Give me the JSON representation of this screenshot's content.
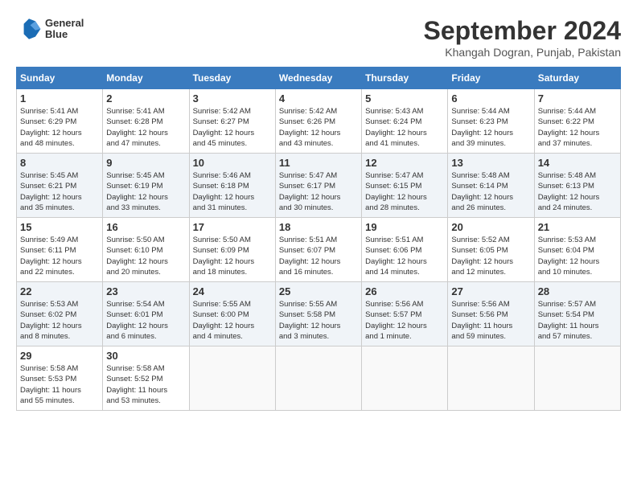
{
  "header": {
    "logo_line1": "General",
    "logo_line2": "Blue",
    "title": "September 2024",
    "subtitle": "Khangah Dogran, Punjab, Pakistan"
  },
  "calendar": {
    "days_of_week": [
      "Sunday",
      "Monday",
      "Tuesday",
      "Wednesday",
      "Thursday",
      "Friday",
      "Saturday"
    ],
    "weeks": [
      [
        {
          "day": "",
          "detail": ""
        },
        {
          "day": "2",
          "detail": "Sunrise: 5:41 AM\nSunset: 6:28 PM\nDaylight: 12 hours\nand 47 minutes."
        },
        {
          "day": "3",
          "detail": "Sunrise: 5:42 AM\nSunset: 6:27 PM\nDaylight: 12 hours\nand 45 minutes."
        },
        {
          "day": "4",
          "detail": "Sunrise: 5:42 AM\nSunset: 6:26 PM\nDaylight: 12 hours\nand 43 minutes."
        },
        {
          "day": "5",
          "detail": "Sunrise: 5:43 AM\nSunset: 6:24 PM\nDaylight: 12 hours\nand 41 minutes."
        },
        {
          "day": "6",
          "detail": "Sunrise: 5:44 AM\nSunset: 6:23 PM\nDaylight: 12 hours\nand 39 minutes."
        },
        {
          "day": "7",
          "detail": "Sunrise: 5:44 AM\nSunset: 6:22 PM\nDaylight: 12 hours\nand 37 minutes."
        }
      ],
      [
        {
          "day": "1",
          "detail": "Sunrise: 5:41 AM\nSunset: 6:29 PM\nDaylight: 12 hours\nand 48 minutes."
        },
        {
          "day": "9",
          "detail": "Sunrise: 5:45 AM\nSunset: 6:19 PM\nDaylight: 12 hours\nand 33 minutes."
        },
        {
          "day": "10",
          "detail": "Sunrise: 5:46 AM\nSunset: 6:18 PM\nDaylight: 12 hours\nand 31 minutes."
        },
        {
          "day": "11",
          "detail": "Sunrise: 5:47 AM\nSunset: 6:17 PM\nDaylight: 12 hours\nand 30 minutes."
        },
        {
          "day": "12",
          "detail": "Sunrise: 5:47 AM\nSunset: 6:15 PM\nDaylight: 12 hours\nand 28 minutes."
        },
        {
          "day": "13",
          "detail": "Sunrise: 5:48 AM\nSunset: 6:14 PM\nDaylight: 12 hours\nand 26 minutes."
        },
        {
          "day": "14",
          "detail": "Sunrise: 5:48 AM\nSunset: 6:13 PM\nDaylight: 12 hours\nand 24 minutes."
        }
      ],
      [
        {
          "day": "8",
          "detail": "Sunrise: 5:45 AM\nSunset: 6:21 PM\nDaylight: 12 hours\nand 35 minutes."
        },
        {
          "day": "16",
          "detail": "Sunrise: 5:50 AM\nSunset: 6:10 PM\nDaylight: 12 hours\nand 20 minutes."
        },
        {
          "day": "17",
          "detail": "Sunrise: 5:50 AM\nSunset: 6:09 PM\nDaylight: 12 hours\nand 18 minutes."
        },
        {
          "day": "18",
          "detail": "Sunrise: 5:51 AM\nSunset: 6:07 PM\nDaylight: 12 hours\nand 16 minutes."
        },
        {
          "day": "19",
          "detail": "Sunrise: 5:51 AM\nSunset: 6:06 PM\nDaylight: 12 hours\nand 14 minutes."
        },
        {
          "day": "20",
          "detail": "Sunrise: 5:52 AM\nSunset: 6:05 PM\nDaylight: 12 hours\nand 12 minutes."
        },
        {
          "day": "21",
          "detail": "Sunrise: 5:53 AM\nSunset: 6:04 PM\nDaylight: 12 hours\nand 10 minutes."
        }
      ],
      [
        {
          "day": "15",
          "detail": "Sunrise: 5:49 AM\nSunset: 6:11 PM\nDaylight: 12 hours\nand 22 minutes."
        },
        {
          "day": "23",
          "detail": "Sunrise: 5:54 AM\nSunset: 6:01 PM\nDaylight: 12 hours\nand 6 minutes."
        },
        {
          "day": "24",
          "detail": "Sunrise: 5:55 AM\nSunset: 6:00 PM\nDaylight: 12 hours\nand 4 minutes."
        },
        {
          "day": "25",
          "detail": "Sunrise: 5:55 AM\nSunset: 5:58 PM\nDaylight: 12 hours\nand 3 minutes."
        },
        {
          "day": "26",
          "detail": "Sunrise: 5:56 AM\nSunset: 5:57 PM\nDaylight: 12 hours\nand 1 minute."
        },
        {
          "day": "27",
          "detail": "Sunrise: 5:56 AM\nSunset: 5:56 PM\nDaylight: 11 hours\nand 59 minutes."
        },
        {
          "day": "28",
          "detail": "Sunrise: 5:57 AM\nSunset: 5:54 PM\nDaylight: 11 hours\nand 57 minutes."
        }
      ],
      [
        {
          "day": "22",
          "detail": "Sunrise: 5:53 AM\nSunset: 6:02 PM\nDaylight: 12 hours\nand 8 minutes."
        },
        {
          "day": "30",
          "detail": "Sunrise: 5:58 AM\nSunset: 5:52 PM\nDaylight: 11 hours\nand 53 minutes."
        },
        {
          "day": "",
          "detail": ""
        },
        {
          "day": "",
          "detail": ""
        },
        {
          "day": "",
          "detail": ""
        },
        {
          "day": "",
          "detail": ""
        },
        {
          "day": "",
          "detail": ""
        }
      ],
      [
        {
          "day": "29",
          "detail": "Sunrise: 5:58 AM\nSunset: 5:53 PM\nDaylight: 11 hours\nand 55 minutes."
        },
        {
          "day": "",
          "detail": ""
        },
        {
          "day": "",
          "detail": ""
        },
        {
          "day": "",
          "detail": ""
        },
        {
          "day": "",
          "detail": ""
        },
        {
          "day": "",
          "detail": ""
        },
        {
          "day": "",
          "detail": ""
        }
      ]
    ]
  }
}
